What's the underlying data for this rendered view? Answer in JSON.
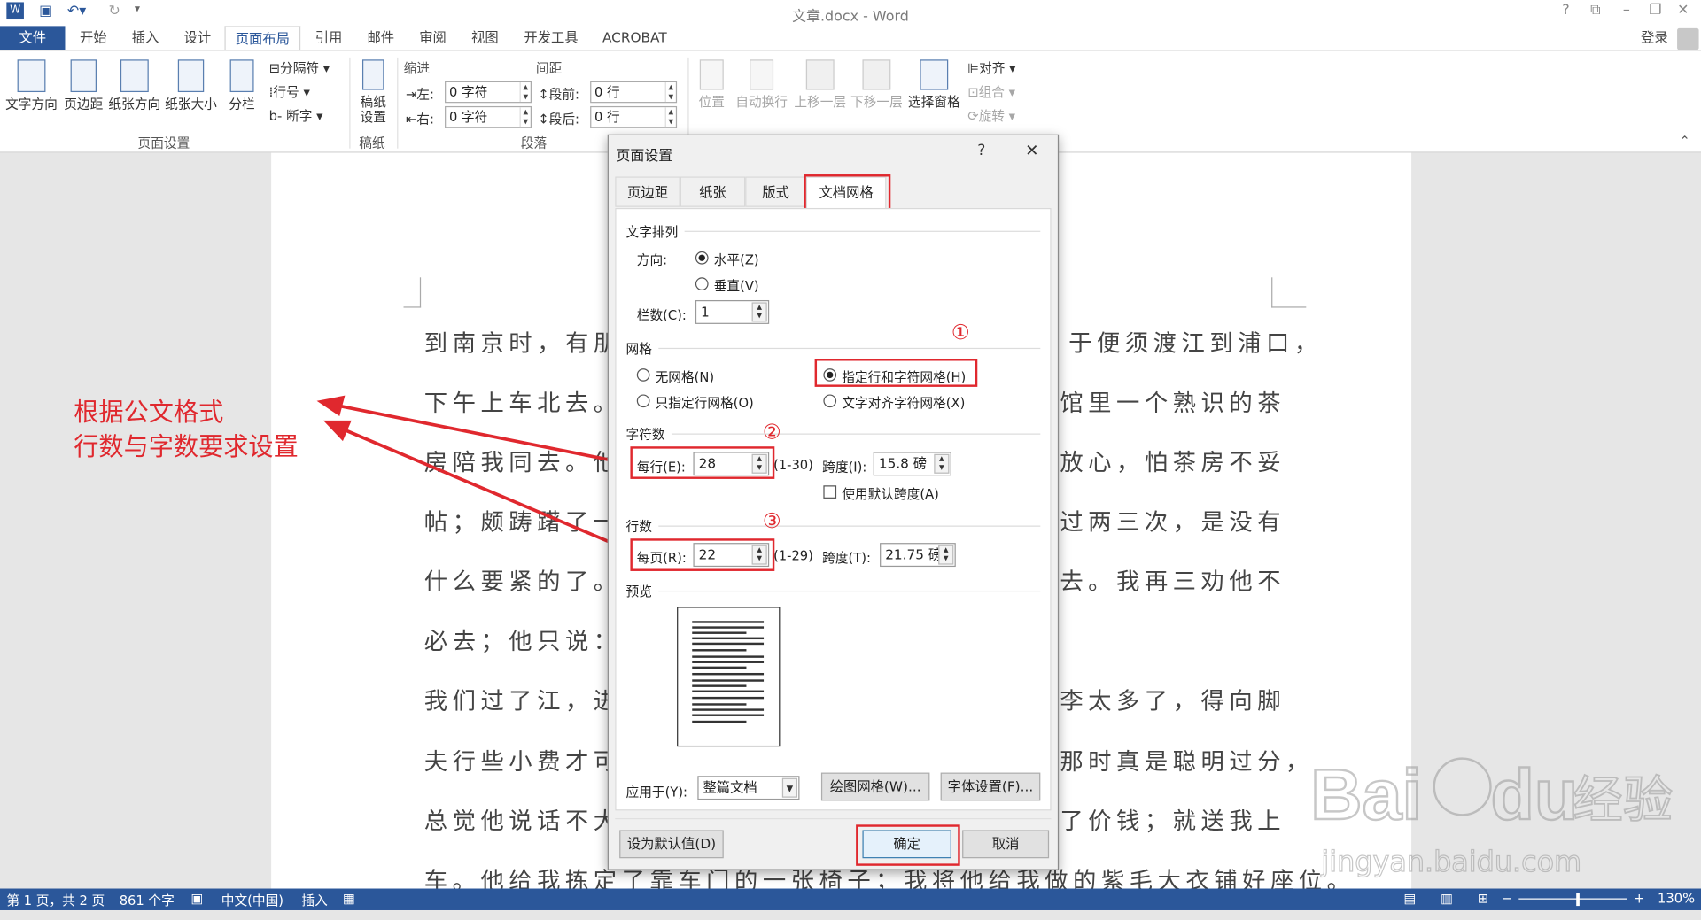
{
  "window": {
    "title": "文章.docx - Word",
    "help": "?",
    "login": "登录",
    "icons": [
      "word-logo-icon",
      "save-icon",
      "undo-icon",
      "redo-icon",
      "customize-qat-icon",
      "help-icon",
      "ribbon-display-icon",
      "minimize-icon",
      "restore-icon",
      "close-icon"
    ]
  },
  "tabs": [
    {
      "label": "文件"
    },
    {
      "label": "开始"
    },
    {
      "label": "插入"
    },
    {
      "label": "设计"
    },
    {
      "label": "页面布局"
    },
    {
      "label": "引用"
    },
    {
      "label": "邮件"
    },
    {
      "label": "审阅"
    },
    {
      "label": "视图"
    },
    {
      "label": "开发工具"
    },
    {
      "label": "ACROBAT"
    }
  ],
  "ribbon": {
    "page_setup": {
      "text_direction": "文字方向",
      "margins": "页边距",
      "orientation": "纸张方向",
      "size": "纸张大小",
      "columns": "分栏",
      "breaks": "分隔符",
      "line_numbers": "行号",
      "hyphenation": "断字",
      "group": "页面设置"
    },
    "draft": {
      "draft_setup_line1": "稿纸",
      "draft_setup_line2": "设置",
      "group": "稿纸"
    },
    "paragraph": {
      "indent_header": "缩进",
      "spacing_header": "间距",
      "left_label": "左:",
      "left_value": "0 字符",
      "right_label": "右:",
      "right_value": "0 字符",
      "before_label": "段前:",
      "before_value": "0 行",
      "after_label": "段后:",
      "after_value": "0 行",
      "group": "段落"
    },
    "arrange": {
      "position": "位置",
      "wrap": "自动换行",
      "forward": "上移一层",
      "backward": "下移一层",
      "selection_pane": "选择窗格",
      "align": "对齐",
      "group_obj": "组合",
      "rotate": "旋转"
    }
  },
  "document": {
    "lines": [
      "到南京时，有朋",
      "下午上车北去。",
      "房陪我同去。他",
      "帖；颇踌躇了一",
      "什么要紧的了。",
      "必去；他只说：",
      "我们过了江，进",
      "夫行些小费才可",
      "总觉他说话不大",
      "车。他给我拣定了靠车门的一张椅子；我将他给我做的紫毛大衣铺好座位。"
    ],
    "right_lines": [
      "于便须渡江到浦口，",
      "馆里一个熟识的茶",
      "放心，怕茶房不妥",
      "过两三次，是没有",
      "去。我再三劝他不",
      "",
      "李太多了，得向脚",
      "那时真是聪明过分，",
      "了价钱；就送我上"
    ]
  },
  "annotation": {
    "line1": "根据公文格式",
    "line2": "行数与字数要求设置"
  },
  "dialog": {
    "title": "页面设置",
    "help": "?",
    "close": "✕",
    "tabs": [
      {
        "label": "页边距"
      },
      {
        "label": "纸张"
      },
      {
        "label": "版式"
      },
      {
        "label": "文档网格"
      }
    ],
    "text_flow": {
      "header": "文字排列",
      "direction_label": "方向:",
      "horizontal": "水平(Z)",
      "vertical": "垂直(V)",
      "columns_label": "栏数(C):",
      "columns_value": "1"
    },
    "grid": {
      "header": "网格",
      "no_grid": "无网格(N)",
      "lines_only": "只指定行网格(O)",
      "lines_and_chars": "指定行和字符网格(H)",
      "snap_to_chars": "文字对齐字符网格(X)"
    },
    "characters": {
      "header": "字符数",
      "per_line_label": "每行(E):",
      "per_line_value": "28",
      "range": "(1-30)",
      "pitch_label": "跨度(I):",
      "pitch_value": "15.8 磅",
      "default_pitch": "使用默认跨度(A)"
    },
    "lines": {
      "header": "行数",
      "per_page_label": "每页(R):",
      "per_page_value": "22",
      "range": "(1-29)",
      "pitch_label": "跨度(T):",
      "pitch_value": "21.75 磅"
    },
    "preview_header": "预览",
    "apply_label": "应用于(Y):",
    "apply_value": "整篇文档",
    "drawing_grid": "绘图网格(W)...",
    "font_settings": "字体设置(F)...",
    "set_default": "设为默认值(D)",
    "ok": "确定",
    "cancel": "取消",
    "markers": [
      "①",
      "②",
      "③"
    ]
  },
  "status": {
    "page": "第 1 页，共 2 页",
    "words": "861 个字",
    "language": "中文(中国)",
    "mode": "插入",
    "zoom": "130%",
    "zoom_minus": "−",
    "zoom_plus": "+"
  },
  "watermark": {
    "brand": "Bai",
    "brand_suffix": "du",
    "cn": "经验",
    "url": "jingyan.baidu.com"
  },
  "colors": {
    "accent": "#2b579a",
    "annotation_red": "#e0282e"
  }
}
